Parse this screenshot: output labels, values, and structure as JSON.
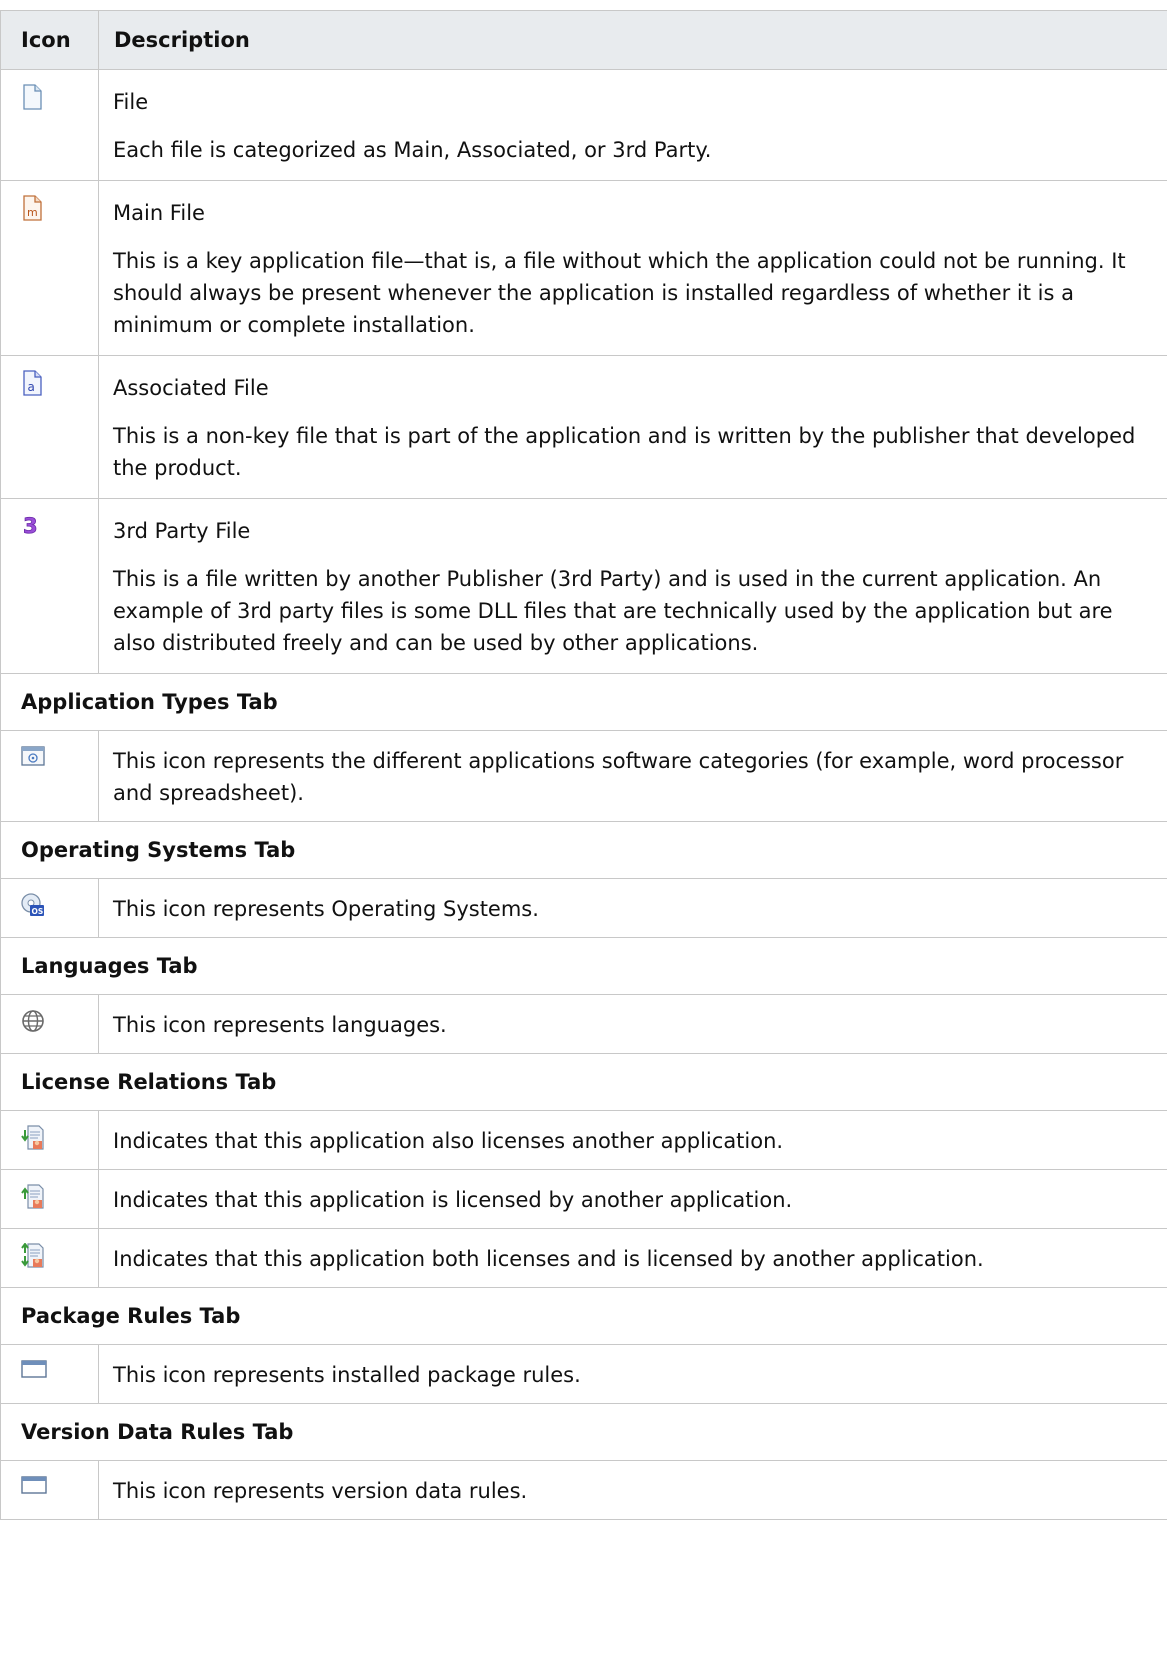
{
  "header": {
    "icon_col": "Icon",
    "desc_col": "Description"
  },
  "rows": [
    {
      "icon": "file-icon",
      "title": "File",
      "desc": "Each file is categorized as Main, Associated, or 3rd Party."
    },
    {
      "icon": "main-file-icon",
      "title": "Main File",
      "desc": "This is a key application file—that is, a file without which the application could not be running. It should always be present whenever the application is installed regardless of whether it is a minimum or complete installation."
    },
    {
      "icon": "associated-file-icon",
      "title": "Associated File",
      "desc": "This is a non-key file that is part of the application and is written by the publisher that developed the product."
    },
    {
      "icon": "third-party-file-icon",
      "title": "3rd Party File",
      "desc": "This is a file written by another Publisher (3rd Party) and is used in the current application. An example of 3rd party files is some DLL files that are technically used by the application but are also distributed freely and can be used by other applications."
    }
  ],
  "sections": {
    "app_types": {
      "title": "Application Types Tab",
      "desc": "This icon represents the different applications software categories (for example, word processor and spreadsheet)."
    },
    "os": {
      "title": "Operating Systems Tab",
      "desc": "This icon represents Operating Systems."
    },
    "languages": {
      "title": "Languages Tab",
      "desc": "This icon represents languages."
    },
    "license": {
      "title": "License Relations Tab",
      "items": [
        "Indicates that this application also licenses another application.",
        "Indicates that this application is licensed by another application.",
        "Indicates that this application both licenses and is licensed by another application."
      ]
    },
    "package": {
      "title": "Package Rules Tab",
      "desc": "This icon represents installed package rules."
    },
    "version": {
      "title": "Version Data Rules Tab",
      "desc": "This icon represents version data rules."
    }
  }
}
